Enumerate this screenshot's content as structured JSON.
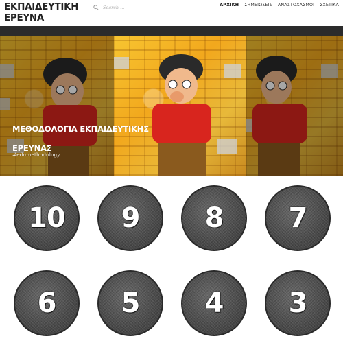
{
  "site": {
    "title_line1": "ΕΚΠΑΙΔΕΥΤΙΚΗ",
    "title_line2": "ΕΡΕΥΝΑ"
  },
  "search": {
    "placeholder": "Search ..."
  },
  "nav": {
    "items": [
      {
        "label": "ΑΡΧΙΚΗ",
        "active": true
      },
      {
        "label": "ΣΗΜΕΙΩΣΕΙΣ",
        "active": false
      },
      {
        "label": "ΑΝΑΣΤΟΧΑΣΜΟΙ",
        "active": false
      },
      {
        "label": "ΣΧΕΤΙΚΑ",
        "active": false
      }
    ]
  },
  "hero": {
    "title_line1": "ΜΕΘΟΔΟΛΟΓΙΑ ΕΚΠΑΙΔΕΥΤΙΚΗΣ",
    "title_line2": "ΕΡΕΥΝΑΣ",
    "hashtag": "#edumethodology"
  },
  "tiles": [
    "10",
    "9",
    "8",
    "7",
    "6",
    "5",
    "4",
    "3"
  ]
}
